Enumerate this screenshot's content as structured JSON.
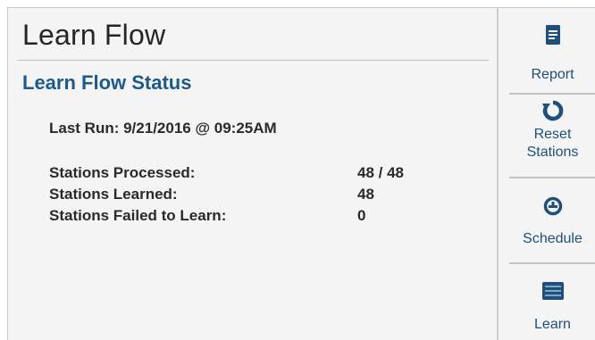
{
  "header": {
    "title": "Learn Flow"
  },
  "status": {
    "section_title": "Learn Flow Status",
    "last_run": "Last Run: 9/21/2016 @ 09:25AM",
    "rows": [
      {
        "label": "Stations Processed:",
        "value": "48 / 48"
      },
      {
        "label": "Stations Learned:",
        "value": "48"
      },
      {
        "label": "Stations Failed to Learn:",
        "value": "0"
      }
    ]
  },
  "sidebar": {
    "items": [
      {
        "label": "Report",
        "icon": "report-icon"
      },
      {
        "label_line1": "Reset",
        "label_line2": "Stations",
        "icon": "reset-icon"
      },
      {
        "label": "Schedule",
        "icon": "schedule-icon"
      },
      {
        "label": "Learn",
        "icon": "learn-icon"
      }
    ]
  },
  "colors": {
    "accent": "#1d5a8a",
    "icon": "#1f4f7a",
    "text": "#2a2a2a",
    "background": "#f4f4f4"
  }
}
